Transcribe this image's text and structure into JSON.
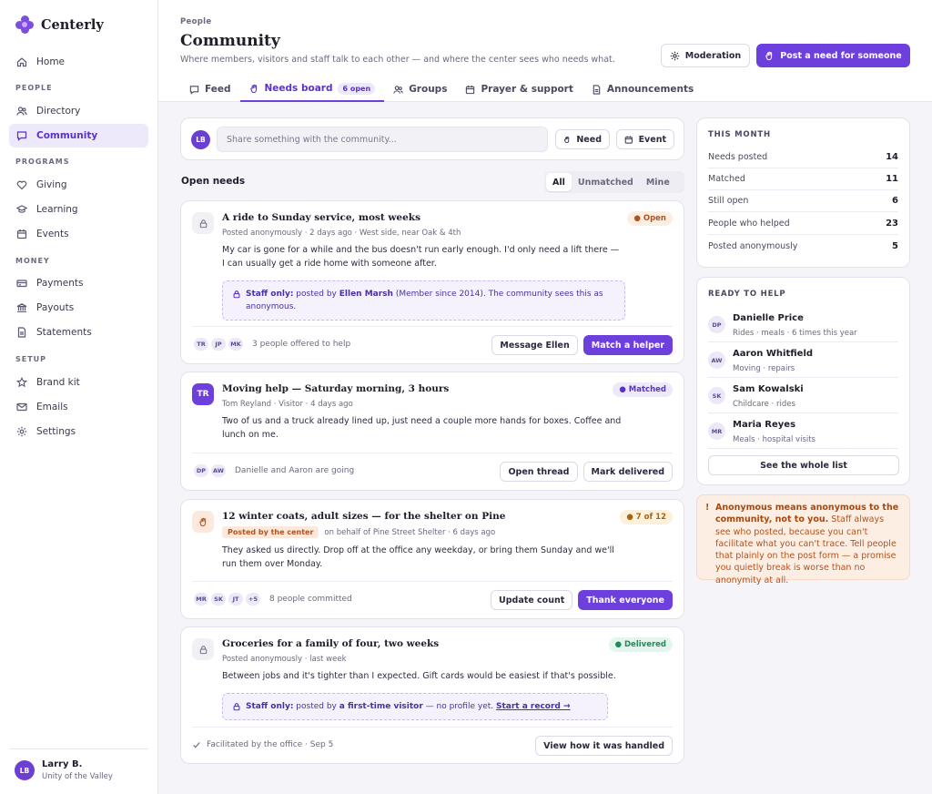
{
  "brand": {
    "name": "Centerly"
  },
  "nav": {
    "home": "Home",
    "sections": [
      "PEOPLE",
      "PROGRAMS",
      "MONEY",
      "SETUP"
    ],
    "directory": "Directory",
    "community": "Community",
    "giving": "Giving",
    "learning": "Learning",
    "events": "Events",
    "payments": "Payments",
    "payouts": "Payouts",
    "statements": "Statements",
    "brand_kit": "Brand kit",
    "emails": "Emails",
    "settings": "Settings"
  },
  "user": {
    "initials": "LB",
    "name": "Larry B.",
    "org": "Unity of the Valley"
  },
  "header": {
    "eyebrow": "People",
    "title": "Community",
    "subtitle": "Where members, visitors and staff talk to each other — and where the center sees who needs what.",
    "moderation": "Moderation",
    "post_need": "Post a need for someone"
  },
  "tabs": [
    {
      "label": "Feed"
    },
    {
      "label": "Needs board",
      "pill": "6 open"
    },
    {
      "label": "Groups"
    },
    {
      "label": "Prayer & support"
    },
    {
      "label": "Announcements"
    }
  ],
  "composer": {
    "initials": "LB",
    "placeholder": "Share something with the community...",
    "need": "Need",
    "event": "Event"
  },
  "needs": {
    "heading": "Open needs",
    "filters": [
      "All",
      "Unmatched",
      "Mine"
    ],
    "n1": {
      "title": "A ride to Sunday service, most weeks",
      "meta": "Posted anonymously · 2 days ago · West side, near Oak & 4th",
      "body": "My car is gone for a while and the bus doesn't run early enough. I'd only need a lift there — I can usually get a ride home with someone after.",
      "badge": "● Open",
      "staff_label": "Staff only:",
      "staff_pre": " posted by ",
      "staff_name": "Ellen Marsh",
      "staff_post": " (Member since 2014). The community sees this as anonymous.",
      "avatars": [
        "TR",
        "JP",
        "MK"
      ],
      "foot": "3 people offered to help",
      "btn1": "Message Ellen",
      "btn2": "Match a helper"
    },
    "n2": {
      "initials": "TR",
      "title": "Moving help — Saturday morning, 3 hours",
      "meta": "Tom Reyland · Visitor · 4 days ago",
      "body": "Two of us and a truck already lined up, just need a couple more hands for boxes. Coffee and lunch on me.",
      "badge": "● Matched",
      "avatars": [
        "DP",
        "AW"
      ],
      "foot": "Danielle and Aaron are going",
      "btn1": "Open thread",
      "btn2": "Mark delivered"
    },
    "n3": {
      "title": "12 winter coats, adult sizes — for the shelter on Pine",
      "tag": "Posted by the center",
      "meta": "on behalf of Pine Street Shelter · 6 days ago",
      "body": "They asked us directly. Drop off at the office any weekday, or bring them Sunday and we'll run them over Monday.",
      "badge": "● 7 of 12",
      "avatars": [
        "MR",
        "SK",
        "JT",
        "+5"
      ],
      "foot": "8 people committed",
      "btn1": "Update count",
      "btn2": "Thank everyone"
    },
    "n4": {
      "title": "Groceries for a family of four, two weeks",
      "meta": "Posted anonymously · last week",
      "body": "Between jobs and it's tighter than I expected. Gift cards would be easiest if that's possible.",
      "badge": "● Delivered",
      "staff_label": "Staff only:",
      "staff_pre": " posted by ",
      "staff_name": "a first-time visitor",
      "staff_post": " — no profile yet. ",
      "staff_link": "Start a record →",
      "foot": "Facilitated by the office · Sep 5",
      "btn1": "View how it was handled"
    }
  },
  "stats": {
    "title": "THIS MONTH",
    "rows": [
      {
        "label": "Needs posted",
        "value": "14"
      },
      {
        "label": "Matched",
        "value": "11"
      },
      {
        "label": "Still open",
        "value": "6"
      },
      {
        "label": "People who helped",
        "value": "23"
      },
      {
        "label": "Posted anonymously",
        "value": "5"
      }
    ]
  },
  "helpers": {
    "title": "READY TO HELP",
    "list": [
      {
        "initials": "DP",
        "name": "Danielle Price",
        "sub": "Rides · meals · 6 times this year"
      },
      {
        "initials": "AW",
        "name": "Aaron Whitfield",
        "sub": "Moving · repairs"
      },
      {
        "initials": "SK",
        "name": "Sam Kowalski",
        "sub": "Childcare · rides"
      },
      {
        "initials": "MR",
        "name": "Maria Reyes",
        "sub": "Meals · hospital visits"
      }
    ],
    "see_all": "See the whole list"
  },
  "notice": {
    "mark": "!",
    "bold": "Anonymous means anonymous to the community, not to you.",
    "text": " Staff always see who posted, because you can't facilitate what you can't trace. Tell people that plainly on the post form — a promise you quietly break is worse than no anonymity at all."
  },
  "colors": {
    "accent": "#6d3fdc",
    "open": "#b5521c",
    "matched": "#5b32c7",
    "delivered": "#1f8a5a"
  }
}
